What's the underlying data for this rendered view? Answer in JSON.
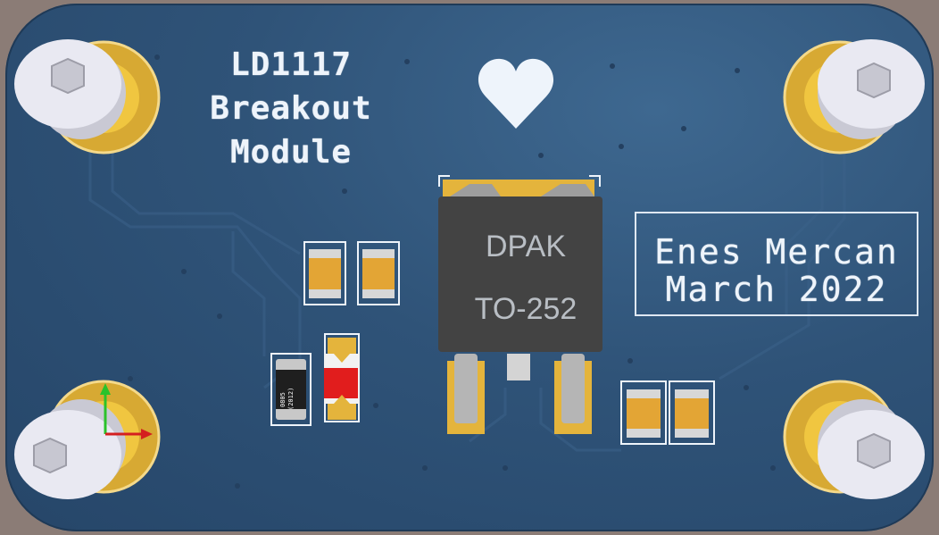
{
  "board": {
    "title_lines": [
      "LD1117",
      "Breakout",
      "Module"
    ],
    "author_lines": [
      "Enes Mercan",
      "March 2022"
    ],
    "package": {
      "name": "DPAK",
      "type": "TO-252"
    },
    "resistor_markings": [
      "0805",
      "(2012)"
    ],
    "logo": "heart-icon",
    "colors": {
      "pcb": "#2f5378",
      "copper_gold": "#e4b43c",
      "silkscreen": "#eef4fb",
      "capacitor": "#e3a535",
      "package_body": "#434343",
      "led_red": "#e11d1d"
    }
  }
}
